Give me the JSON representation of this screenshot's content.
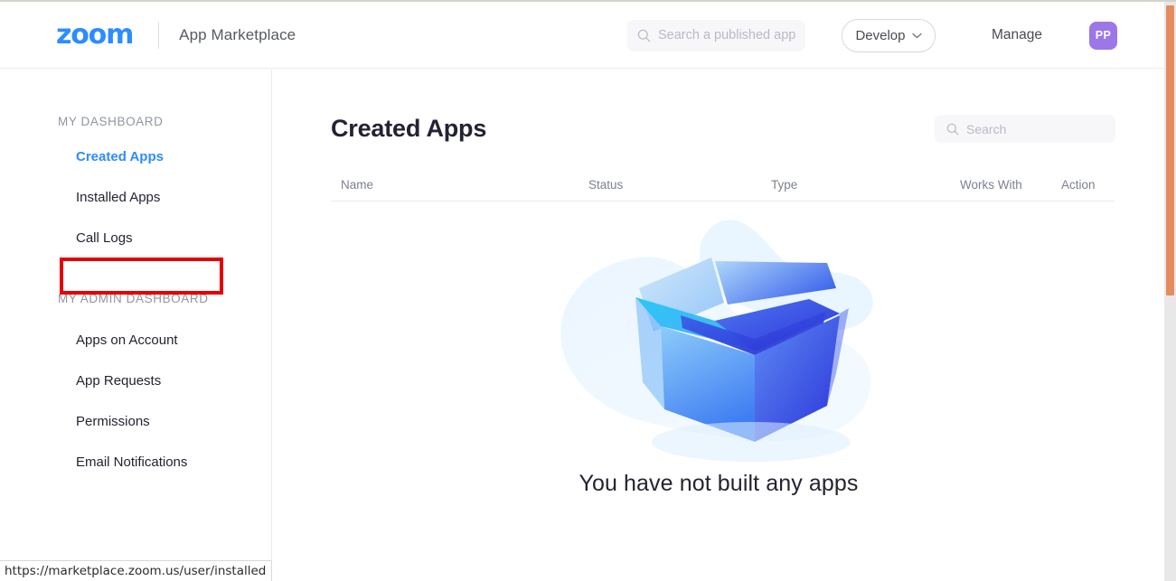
{
  "header": {
    "logo_text": "zoom",
    "title": "App Marketplace",
    "search": {
      "icon": "search-icon",
      "placeholder": "Search a published app",
      "value": ""
    },
    "develop_button": {
      "label": "Develop",
      "icon": "chevron-down-icon"
    },
    "manage_link": "Manage",
    "avatar": {
      "initials": "PP",
      "color": "#9b77e8"
    }
  },
  "sidebar": {
    "sections": [
      {
        "title": "MY DASHBOARD",
        "items": [
          {
            "label": "Created Apps",
            "active": true
          },
          {
            "label": "Installed Apps",
            "active": false,
            "highlighted": true
          },
          {
            "label": "Call Logs",
            "active": false
          }
        ]
      },
      {
        "title": "MY ADMIN DASHBOARD",
        "items": [
          {
            "label": "Apps on Account",
            "active": false
          },
          {
            "label": "App Requests",
            "active": false
          },
          {
            "label": "Permissions",
            "active": false
          },
          {
            "label": "Email Notifications",
            "active": false
          }
        ]
      }
    ],
    "highlight_color": "#e60000"
  },
  "main": {
    "title": "Created Apps",
    "search": {
      "icon": "search-icon",
      "placeholder": "Search",
      "value": ""
    },
    "table": {
      "columns": [
        "Name",
        "Status",
        "Type",
        "Works With",
        "Action"
      ],
      "rows": []
    },
    "empty_state": {
      "illustration": "empty-box-illustration",
      "message": "You have not built any apps"
    }
  },
  "status_bar": {
    "url": "https://marketplace.zoom.us/user/installed"
  },
  "scrollbar": {
    "orientation": "vertical",
    "thumb_color": "#e58c5f",
    "track_color": "#e8e8e8"
  },
  "colors": {
    "accent": "#2D8CFF",
    "text": "#232333",
    "muted": "#7d8090",
    "highlight": "#e60000"
  }
}
